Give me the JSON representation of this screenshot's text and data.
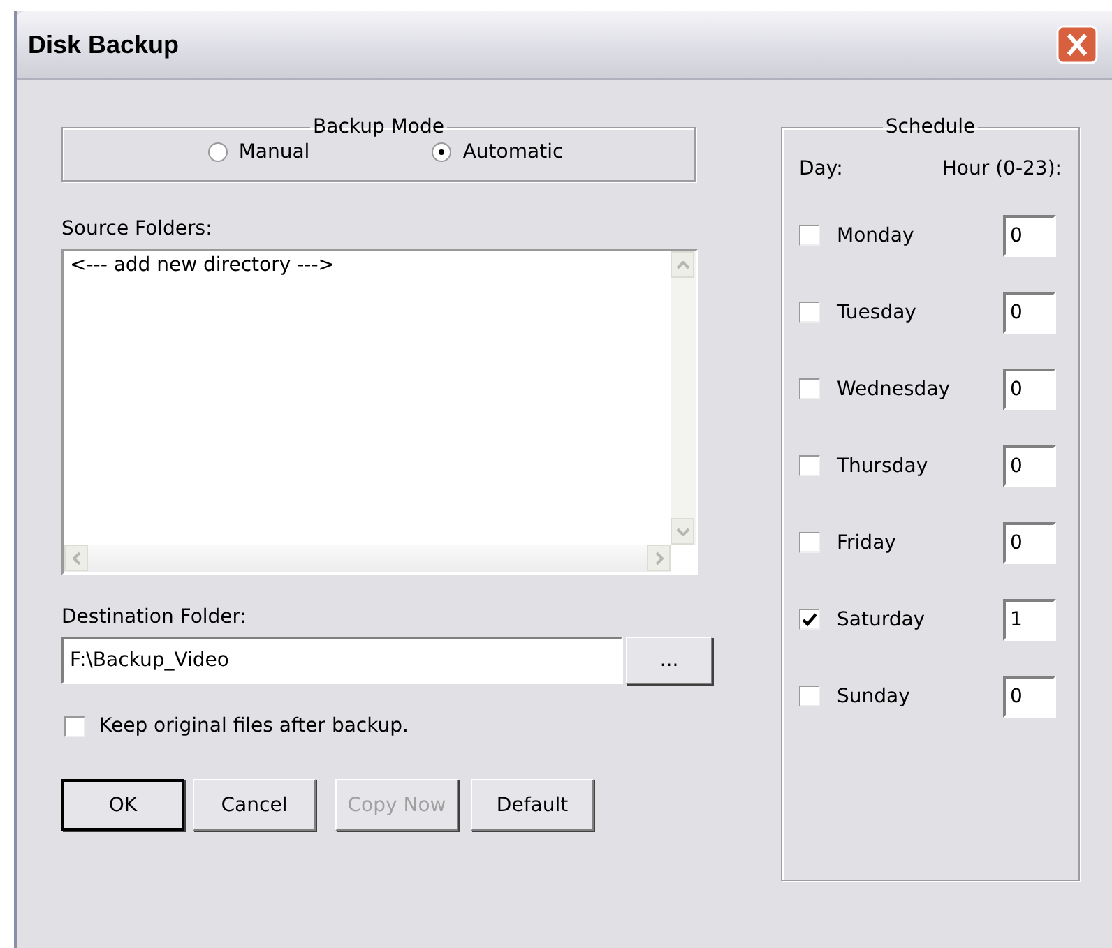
{
  "window": {
    "title": "Disk Backup"
  },
  "backup_mode": {
    "title": "Backup Mode",
    "options": [
      {
        "label": "Manual",
        "selected": false
      },
      {
        "label": "Automatic",
        "selected": true
      }
    ]
  },
  "source_folders": {
    "label": "Source Folders:",
    "items": [
      "<--- add new directory --->"
    ]
  },
  "destination": {
    "label": "Destination Folder:",
    "value": "F:\\Backup_Video",
    "browse": "..."
  },
  "keep_original": {
    "label": "Keep original files after backup.",
    "checked": false
  },
  "buttons": [
    {
      "label": "OK",
      "default": true,
      "disabled": false
    },
    {
      "label": "Cancel",
      "default": false,
      "disabled": false
    },
    {
      "label": "Copy Now",
      "default": false,
      "disabled": true
    },
    {
      "label": "Default",
      "default": false,
      "disabled": false
    }
  ],
  "schedule": {
    "title": "Schedule",
    "day_header": "Day:",
    "hour_header": "Hour (0-23):",
    "days": [
      {
        "day": "Monday",
        "checked": false,
        "hour": "0"
      },
      {
        "day": "Tuesday",
        "checked": false,
        "hour": "0"
      },
      {
        "day": "Wednesday",
        "checked": false,
        "hour": "0"
      },
      {
        "day": "Thursday",
        "checked": false,
        "hour": "0"
      },
      {
        "day": "Friday",
        "checked": false,
        "hour": "0"
      },
      {
        "day": "Saturday",
        "checked": true,
        "hour": "1"
      },
      {
        "day": "Sunday",
        "checked": false,
        "hour": "0"
      }
    ]
  }
}
